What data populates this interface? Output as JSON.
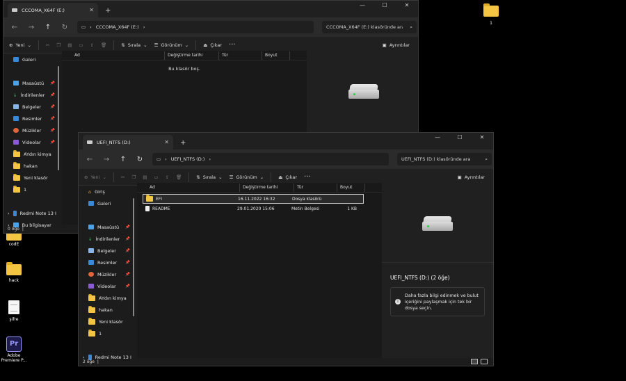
{
  "desktop": {
    "icons": [
      {
        "label": "1"
      },
      {
        "label": "codE"
      },
      {
        "label": "hack"
      },
      {
        "label": "şifre"
      },
      {
        "label": "Adobe Premiere P..."
      }
    ]
  },
  "win_back": {
    "tab_title": "CCCOMA_X64F (E:)",
    "path": "CCCOMA_X64F (E:)",
    "search_placeholder": "CCCOMA_X64F (E:) klasöründe ara",
    "commands": {
      "new": "Yeni",
      "sort": "Sırala",
      "view": "Görünüm",
      "eject": "Çıkar",
      "details": "Ayrıntılar"
    },
    "sidebar": [
      "Galeri",
      "Masaüstü",
      "İndirilenler",
      "Belgeler",
      "Resimler",
      "Müzikler",
      "Videolar",
      "AYdın kimya",
      "hakan",
      "Yeni klasör",
      "1",
      "Redmi Note 13 I",
      "Bu bilgisayar"
    ],
    "columns": [
      "Ad",
      "Değiştirme tarihi",
      "Tür",
      "Boyut"
    ],
    "empty_text": "Bu klasör boş.",
    "status": "0 öğe"
  },
  "win_front": {
    "tab_title": "UEFI_NTFS (D:)",
    "path": "UEFI_NTFS (D:)",
    "search_placeholder": "UEFI_NTFS (D:) klasöründe ara",
    "commands": {
      "new": "Yeni",
      "sort": "Sırala",
      "view": "Görünüm",
      "eject": "Çıkar",
      "details": "Ayrıntılar"
    },
    "sidebar": [
      "Giriş",
      "Galeri",
      "Masaüstü",
      "İndirilenler",
      "Belgeler",
      "Resimler",
      "Müzikler",
      "Videolar",
      "AYdın kimya",
      "hakan",
      "Yeni klasör",
      "1",
      "Redmi Note 13 I"
    ],
    "columns": [
      "Ad",
      "Değiştirme tarihi",
      "Tür",
      "Boyut"
    ],
    "files": [
      {
        "name": "EFI",
        "date": "16.11.2022 16:32",
        "type": "Dosya klasörü",
        "size": ""
      },
      {
        "name": "README",
        "date": "29.01.2020 15:06",
        "type": "Metin Belgesi",
        "size": "1 KB"
      }
    ],
    "details_title": "UEFI_NTFS (D:) (2 öğe)",
    "details_info": "Daha fazla bilgi edinmek ve bulut içeriğini paylaşmak için tek bir dosya seçin.",
    "status": "2 öğe"
  }
}
